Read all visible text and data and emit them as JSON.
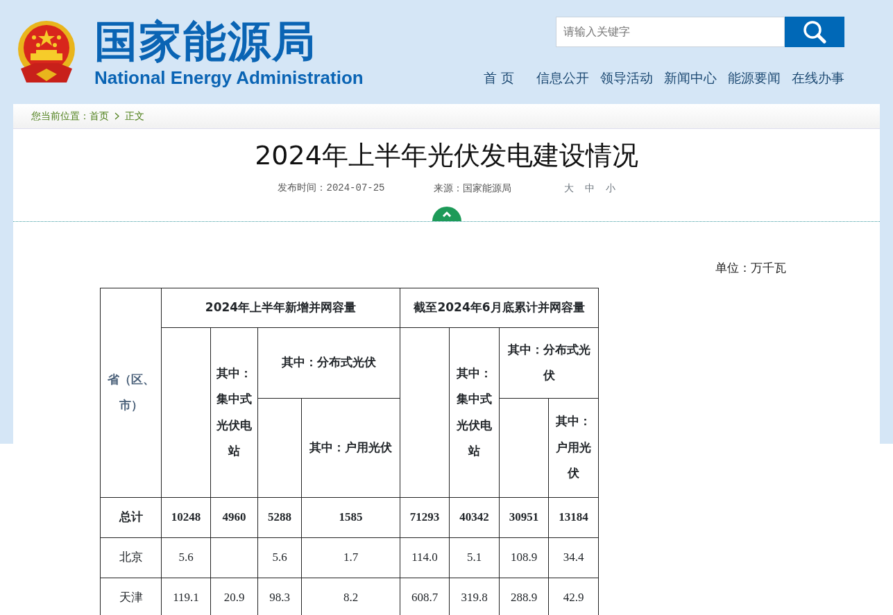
{
  "header": {
    "logo_cn": "国家能源局",
    "logo_en": "National Energy Administration",
    "search": {
      "placeholder": "请输入关键字"
    },
    "nav": [
      "首 页",
      "信息公开",
      "领导活动",
      "新闻中心",
      "能源要闻",
      "在线办事"
    ]
  },
  "breadcrumb": {
    "prefix": "您当前位置：",
    "items": [
      "首页",
      "正文"
    ]
  },
  "article": {
    "title": "2024年上半年光伏发电建设情况",
    "published": "发布时间：2024-07-25",
    "source": "来源：国家能源局",
    "font_sizes": [
      "大",
      "中",
      "小"
    ],
    "unit": "单位：万千瓦",
    "table": {
      "header_rows": [
        [
          {
            "text": "省（区、市）",
            "rowspan": 3
          },
          {
            "text": "2024年上半年新增并网容量",
            "colspan": 4
          },
          {
            "text": "截至2024年6月底累计并网容量",
            "colspan": 4
          }
        ],
        [
          {
            "rowspan": 2
          },
          {
            "text": "其中：集中式光伏电站",
            "rowspan": 2
          },
          {
            "text": "其中：分布式光伏",
            "colspan": 2
          },
          {
            "rowspan": 2
          },
          {
            "text": "其中：集中式光伏电站",
            "rowspan": 2
          },
          {
            "text": "其中：分布式光伏",
            "colspan": 2
          }
        ],
        [
          {},
          {
            "text": "其中：户用光伏"
          },
          {},
          {
            "text": "其中：户用光伏"
          }
        ]
      ],
      "rows": [
        {
          "kind": "total",
          "cells": [
            "总计",
            "10248",
            "4960",
            "5288",
            "1585",
            "71293",
            "40342",
            "30951",
            "13184"
          ]
        },
        {
          "kind": "province",
          "cells": [
            "北京",
            "5.6",
            null,
            "5.6",
            "1.7",
            "114.0",
            "5.1",
            "108.9",
            "34.4"
          ]
        },
        {
          "kind": "province",
          "cells": [
            "天津",
            "119.1",
            "20.9",
            "98.3",
            "8.2",
            "608.7",
            "319.8",
            "288.9",
            "42.9"
          ]
        }
      ]
    }
  }
}
